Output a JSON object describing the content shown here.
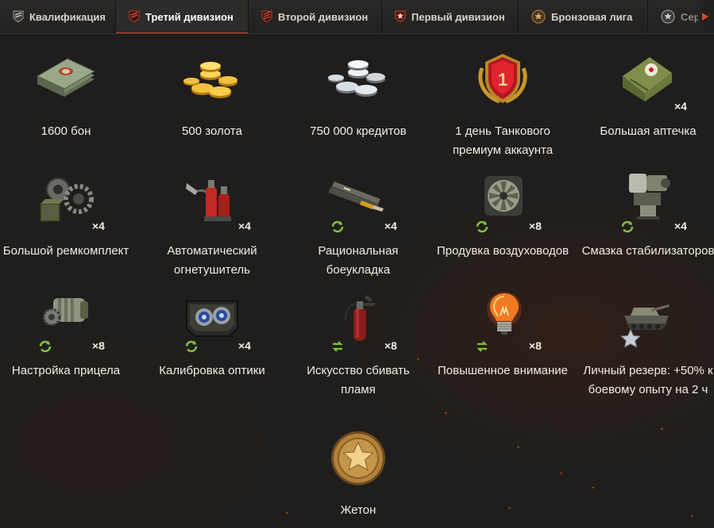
{
  "tabs": [
    {
      "label": "Квалификация",
      "active": false
    },
    {
      "label": "Третий дивизион",
      "active": true
    },
    {
      "label": "Второй дивизион",
      "active": false
    },
    {
      "label": "Первый дивизион",
      "active": false
    },
    {
      "label": "Бронзовая лига",
      "active": false
    },
    {
      "label": "Сер",
      "active": false
    }
  ],
  "rewards": [
    {
      "name": "1600 бон",
      "qty": "",
      "icon": "bonds-icon"
    },
    {
      "name": "500 золота",
      "qty": "",
      "icon": "gold-coins-icon"
    },
    {
      "name": "750 000 кредитов",
      "qty": "",
      "icon": "credits-icon"
    },
    {
      "name": "1 день Танкового премиум аккаунта",
      "qty": "",
      "icon": "premium-account-icon"
    },
    {
      "name": "Большая аптечка",
      "qty": "×4",
      "icon": "large-first-aid-kit-icon"
    },
    {
      "name": "Большой ремкомплект",
      "qty": "×4",
      "icon": "large-repair-kit-icon"
    },
    {
      "name": "Автоматический огнетушитель",
      "qty": "×4",
      "icon": "automatic-fire-extinguisher-icon"
    },
    {
      "name": "Рациональная боеукладка",
      "qty": "×4",
      "icon": "ammo-rack-icon"
    },
    {
      "name": "Продувка воздуховодов",
      "qty": "×8",
      "icon": "air-duct-fan-icon"
    },
    {
      "name": "Смазка стабилизаторов",
      "qty": "×4",
      "icon": "stabilizer-lubricant-icon"
    },
    {
      "name": "Настройка прицела",
      "qty": "×8",
      "icon": "gun-sight-tuning-icon"
    },
    {
      "name": "Калибровка оптики",
      "qty": "×4",
      "icon": "optics-calibration-icon"
    },
    {
      "name": "Искусство сбивать пламя",
      "qty": "×8",
      "icon": "fire-extinguisher-icon"
    },
    {
      "name": "Повышенное внимание",
      "qty": "×8",
      "icon": "light-bulb-icon"
    },
    {
      "name": "Личный резерв: +50% к боевому опыту на 2 ч",
      "qty": "",
      "icon": "personal-reserve-tank-icon"
    },
    {
      "name": "Жетон",
      "qty": "",
      "icon": "token-star-icon"
    }
  ],
  "colors": {
    "accent": "#d4462a",
    "badge_green": "#7ec23a",
    "text": "#f2ecdf"
  }
}
